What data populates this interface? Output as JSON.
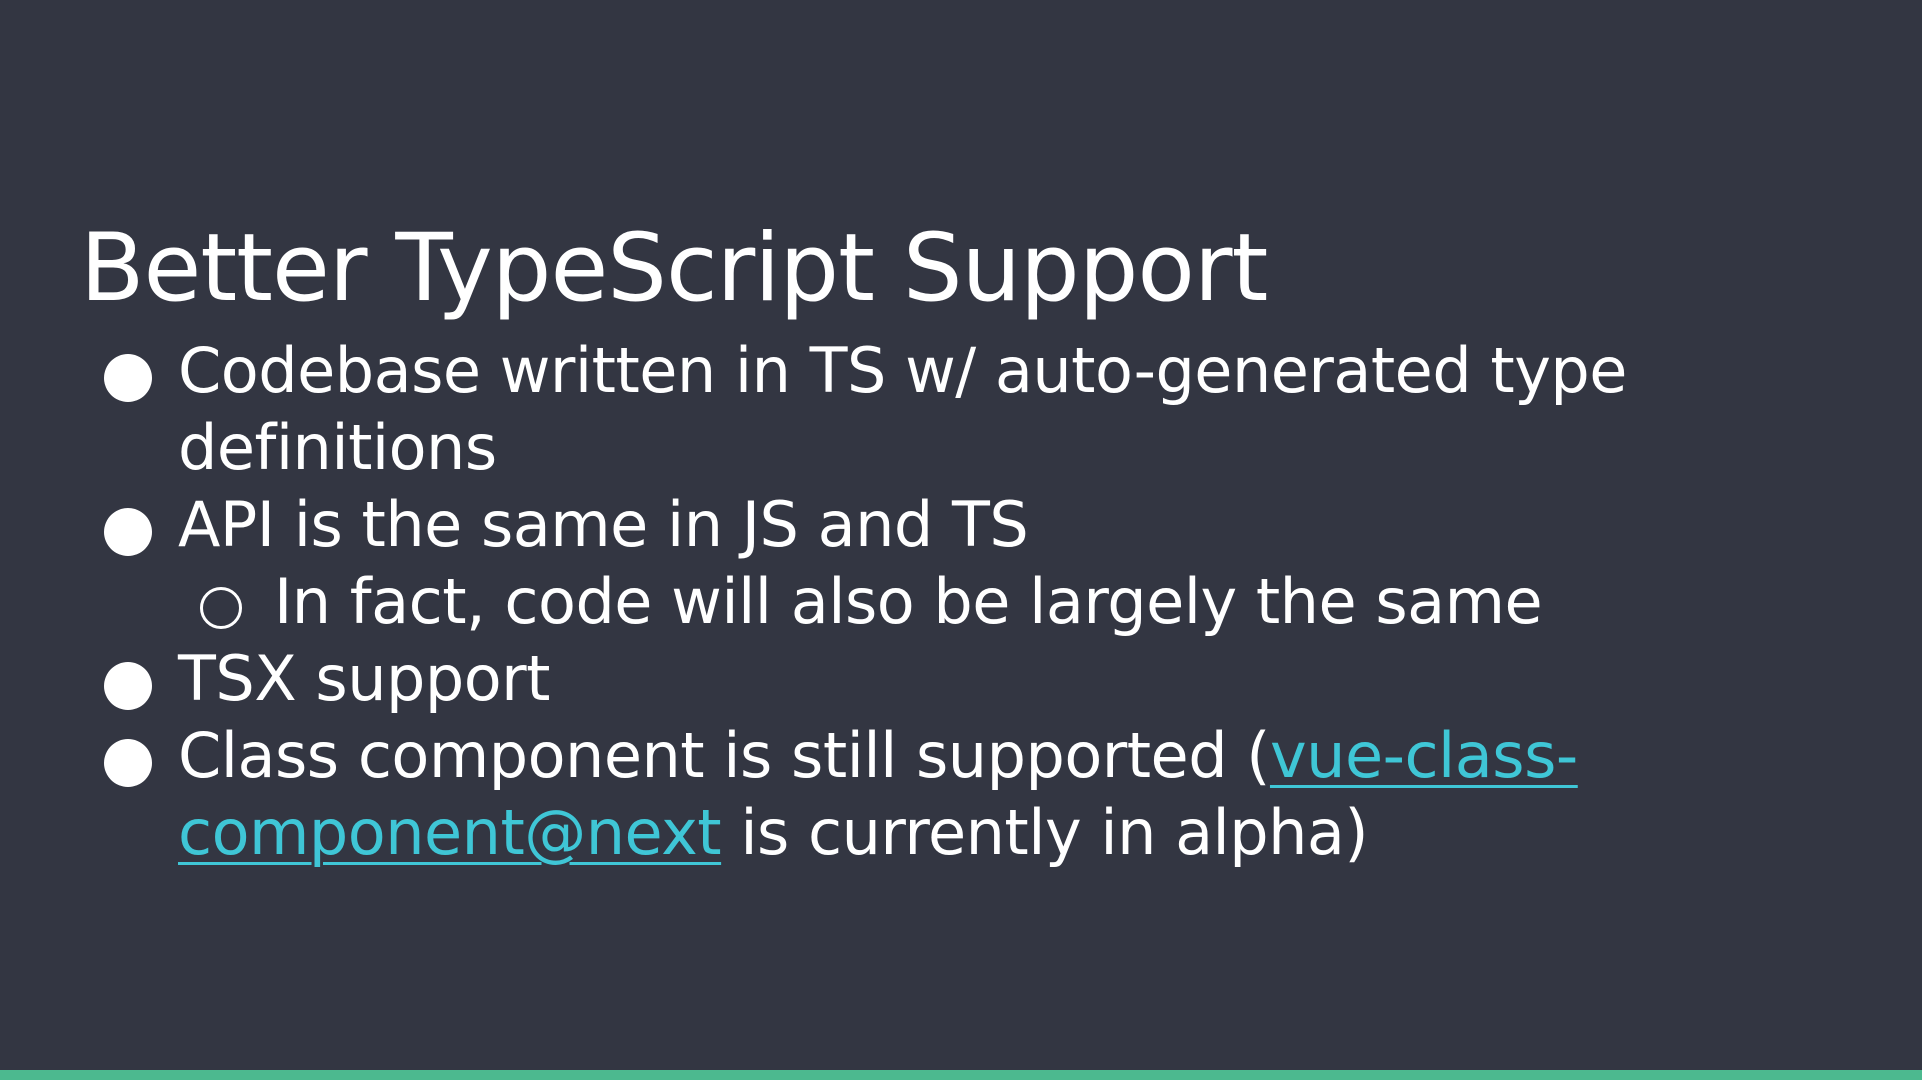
{
  "slide": {
    "title": "Better TypeScript Support",
    "bullets": [
      {
        "text": "Codebase written in TS w/ auto-generated type definitions"
      },
      {
        "text": "API is the same in JS and TS"
      },
      {
        "text": "In fact, code will also be largely the same"
      },
      {
        "text": "TSX support"
      },
      {
        "text_before": "Class component is still supported (",
        "link_text": "vue-class-component@next",
        "text_after": " is currently in alpha)"
      }
    ]
  },
  "colors": {
    "background": "#333642",
    "text": "#ffffff",
    "link": "#3fc6d6",
    "accent_bar": "#4cb98f"
  }
}
